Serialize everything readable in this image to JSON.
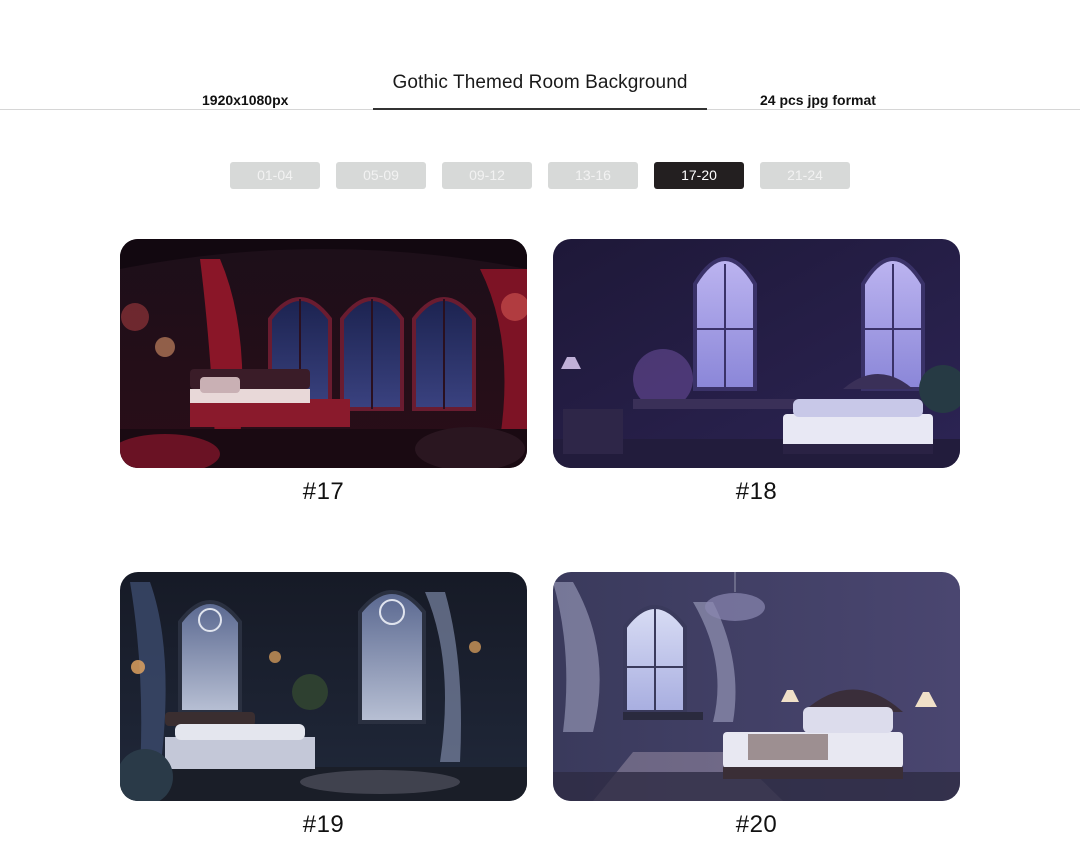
{
  "header": {
    "title": "Gothic Themed Room Background",
    "resolution": "1920x1080px",
    "format": "24 pcs jpg format"
  },
  "tabs": [
    {
      "label": "01-04",
      "active": false
    },
    {
      "label": "05-09",
      "active": false
    },
    {
      "label": "09-12",
      "active": false
    },
    {
      "label": "13-16",
      "active": false
    },
    {
      "label": "17-20",
      "active": true
    },
    {
      "label": "21-24",
      "active": false
    }
  ],
  "gallery": [
    {
      "label": "#17",
      "scene": "crimson gothic bedroom with arched windows and red curtains"
    },
    {
      "label": "#18",
      "scene": "violet gothic bedroom with tall lancet windows and white bed"
    },
    {
      "label": "#19",
      "scene": "dark blue gothic bedroom with rose windows and plants"
    },
    {
      "label": "#20",
      "scene": "lavender gothic bedroom with chandelier and carved headboard"
    }
  ],
  "colors": {
    "tab_inactive": "#d7d9d8",
    "tab_active": "#231f20",
    "text": "#111111"
  }
}
